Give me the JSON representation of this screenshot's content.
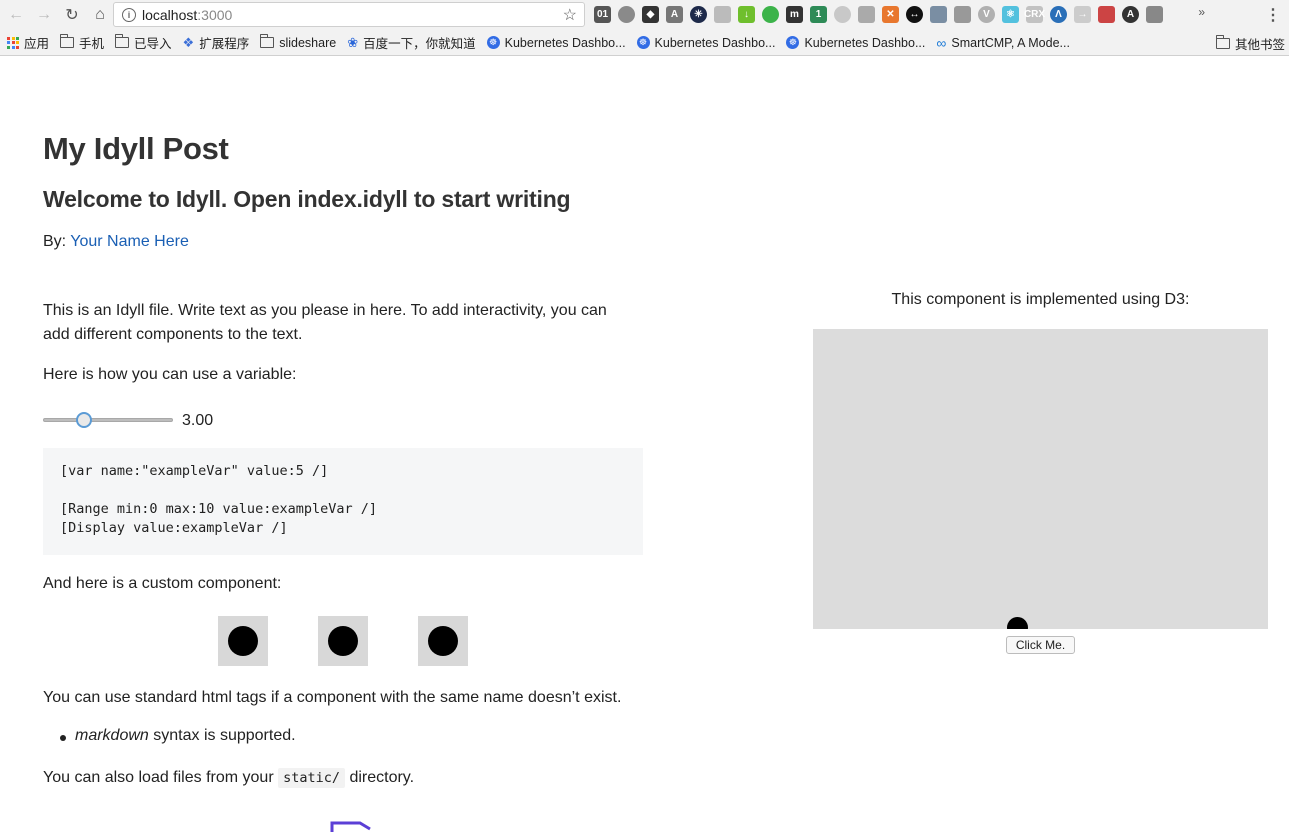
{
  "browser": {
    "url_host": "localhost",
    "url_port": ":3000",
    "extension_icons": [
      {
        "name": "binary-icon",
        "color": "#555555",
        "text": "01"
      },
      {
        "name": "screen-icon",
        "color": "#8a8a8a",
        "text": ""
      },
      {
        "name": "diamond-icon",
        "color": "#333333",
        "text": "◆"
      },
      {
        "name": "angular-icon",
        "color": "#777777",
        "text": "A"
      },
      {
        "name": "snowflake-icon",
        "color": "#1e2a4a",
        "text": "✳"
      },
      {
        "name": "network-icon",
        "color": "#bbbbbb",
        "text": ""
      },
      {
        "name": "download-icon",
        "color": "#6fbf2d",
        "text": "↓"
      },
      {
        "name": "green-circle-icon",
        "color": "#3cb34a",
        "text": ""
      },
      {
        "name": "m-icon",
        "color": "#333333",
        "text": "m"
      },
      {
        "name": "badge-icon",
        "color": "#2e8b57",
        "text": "1"
      },
      {
        "name": "grey-circle-icon",
        "color": "#c8c8c8",
        "text": ""
      },
      {
        "name": "camera-icon",
        "color": "#aaaaaa",
        "text": ""
      },
      {
        "name": "close-circle-icon",
        "color": "#e8772e",
        "text": "✕"
      },
      {
        "name": "code-icon",
        "color": "#111111",
        "text": "↔"
      },
      {
        "name": "bus-icon",
        "color": "#7a8ea3",
        "text": ""
      },
      {
        "name": "shield-icon",
        "color": "#999999",
        "text": ""
      },
      {
        "name": "vue-icon",
        "color": "#b0b0b0",
        "text": "V"
      },
      {
        "name": "react-icon",
        "color": "#53c1de",
        "text": "⚛"
      },
      {
        "name": "crx-icon",
        "color": "#c2c2c2",
        "text": "CRX"
      },
      {
        "name": "lambda-icon",
        "color": "#2a6fb8",
        "text": "Λ"
      },
      {
        "name": "arrow-icon",
        "color": "#cccccc",
        "text": "→"
      },
      {
        "name": "photo-icon",
        "color": "#c44",
        "text": ""
      },
      {
        "name": "font-icon",
        "color": "#333333",
        "text": "A"
      },
      {
        "name": "search-page-icon",
        "color": "#888888",
        "text": ""
      }
    ]
  },
  "bookmarks": {
    "items": [
      {
        "label": "应用",
        "type": "apps"
      },
      {
        "label": "手机",
        "type": "folder"
      },
      {
        "label": "已导入",
        "type": "folder"
      },
      {
        "label": "扩展程序",
        "type": "puzzle"
      },
      {
        "label": "slideshare",
        "type": "folder"
      },
      {
        "label": "百度一下，你就知道",
        "type": "paw"
      },
      {
        "label": "Kubernetes Dashbo...",
        "type": "k8s"
      },
      {
        "label": "Kubernetes Dashbo...",
        "type": "k8s"
      },
      {
        "label": "Kubernetes Dashbo...",
        "type": "k8s"
      },
      {
        "label": "SmartCMP, A Mode...",
        "type": "link"
      }
    ],
    "more": "»",
    "other": "其他书签"
  },
  "page": {
    "title": "My Idyll Post",
    "subtitle": "Welcome to Idyll. Open index.idyll to start writing",
    "by_label": "By:",
    "author": "Your Name Here",
    "intro_line1": "This is an Idyll file. Write text as you please in here. To add interactivity, you can",
    "intro_line2": "add different components to the text.",
    "variable_text": "Here is how you can use a variable:",
    "slider_value": "3.00",
    "slider_fraction": 0.3,
    "code_lines": [
      "[var name:\"exampleVar\" value:5 /]",
      "",
      "[Range min:0 max:10 value:exampleVar /]",
      "[Display value:exampleVar /]"
    ],
    "custom_text": "And here is a custom component:",
    "html_text": "You can use standard html tags if a component with the same name doesn’t exist.",
    "list_em": "markdown",
    "list_rest": " syntax is supported.",
    "static_before": "You can also load files from your ",
    "static_code": "static/",
    "static_after": " directory."
  },
  "d3": {
    "caption": "This component is implemented using D3:",
    "button_label": "Click Me."
  }
}
